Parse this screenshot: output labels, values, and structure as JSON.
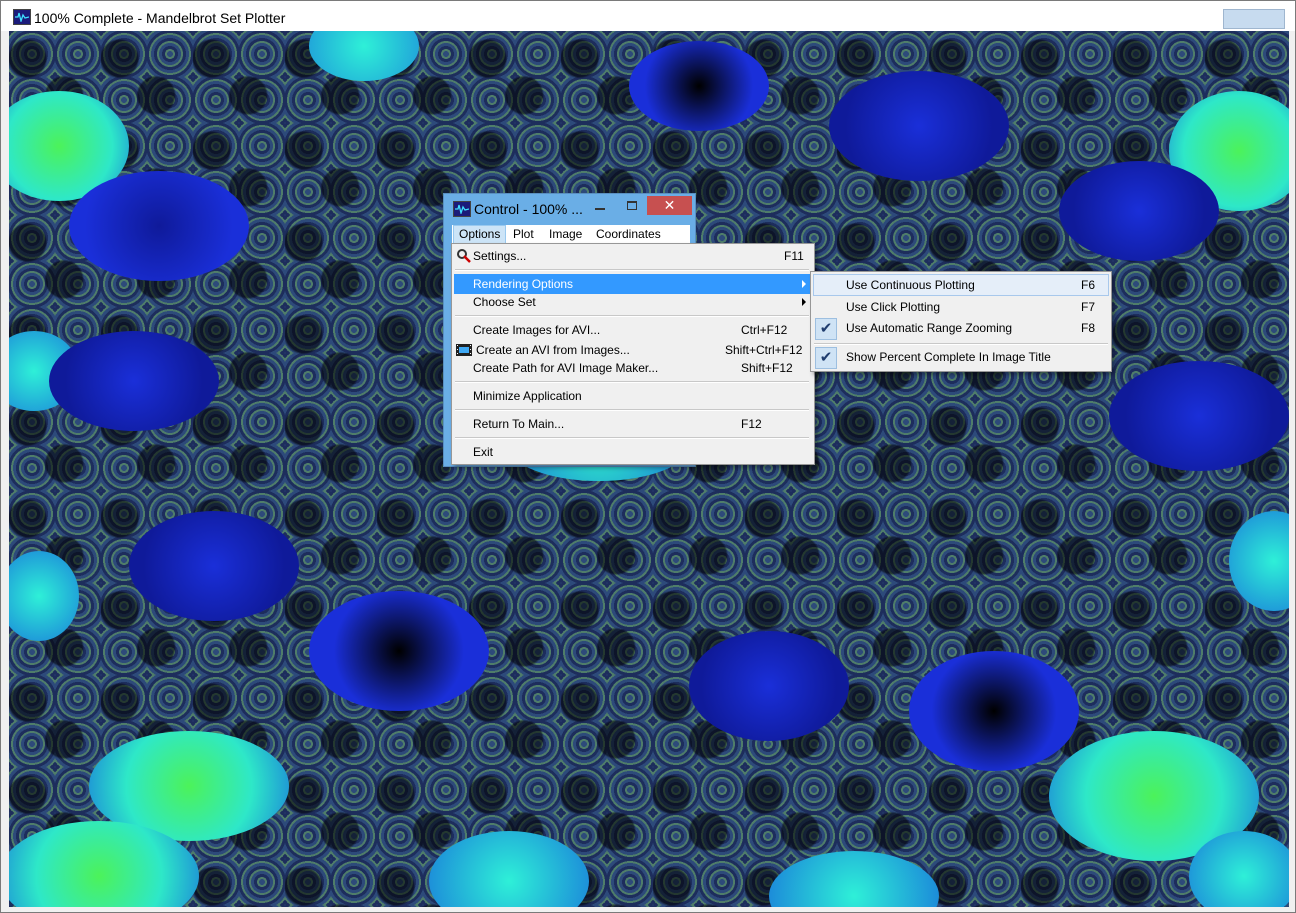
{
  "window": {
    "title": "100% Complete - Mandelbrot Set Plotter",
    "icon": "waveform-app-icon"
  },
  "control": {
    "title": "Control - 100% ...",
    "close_glyph": "✕",
    "menubar": [
      "Options",
      "Plot",
      "Image",
      "Coordinates"
    ]
  },
  "options_menu": {
    "settings": {
      "label": "Settings...",
      "shortcut": "F11",
      "icon": "settings-icon"
    },
    "rendering_options": {
      "label": "Rendering Options"
    },
    "choose_set": {
      "label": "Choose Set"
    },
    "create_images_avi": {
      "label": "Create Images for AVI...",
      "shortcut": "Ctrl+F12"
    },
    "create_avi": {
      "label": "Create an AVI from Images...",
      "shortcut": "Shift+Ctrl+F12",
      "icon": "film-icon"
    },
    "create_path": {
      "label": "Create Path for AVI Image Maker...",
      "shortcut": "Shift+F12"
    },
    "minimize": {
      "label": "Minimize Application"
    },
    "return_main": {
      "label": "Return To Main...",
      "shortcut": "F12"
    },
    "exit": {
      "label": "Exit"
    }
  },
  "rendering_submenu": [
    {
      "label": "Use Continuous Plotting",
      "shortcut": "F6",
      "checked": false
    },
    {
      "label": "Use Click Plotting",
      "shortcut": "F7",
      "checked": false
    },
    {
      "label": "Use Automatic Range Zooming",
      "shortcut": "F8",
      "checked": true
    },
    {
      "label": "Show Percent Complete In Image Title",
      "shortcut": "",
      "checked": true
    }
  ],
  "colors": {
    "highlight": "#3399ff",
    "control_frame": "#6aaee6",
    "close_button": "#c75050",
    "fractal_dark": "#000000",
    "fractal_blue": "#1a2fd9",
    "fractal_cyan": "#2ef0d8",
    "fractal_green": "#4cf25a"
  }
}
